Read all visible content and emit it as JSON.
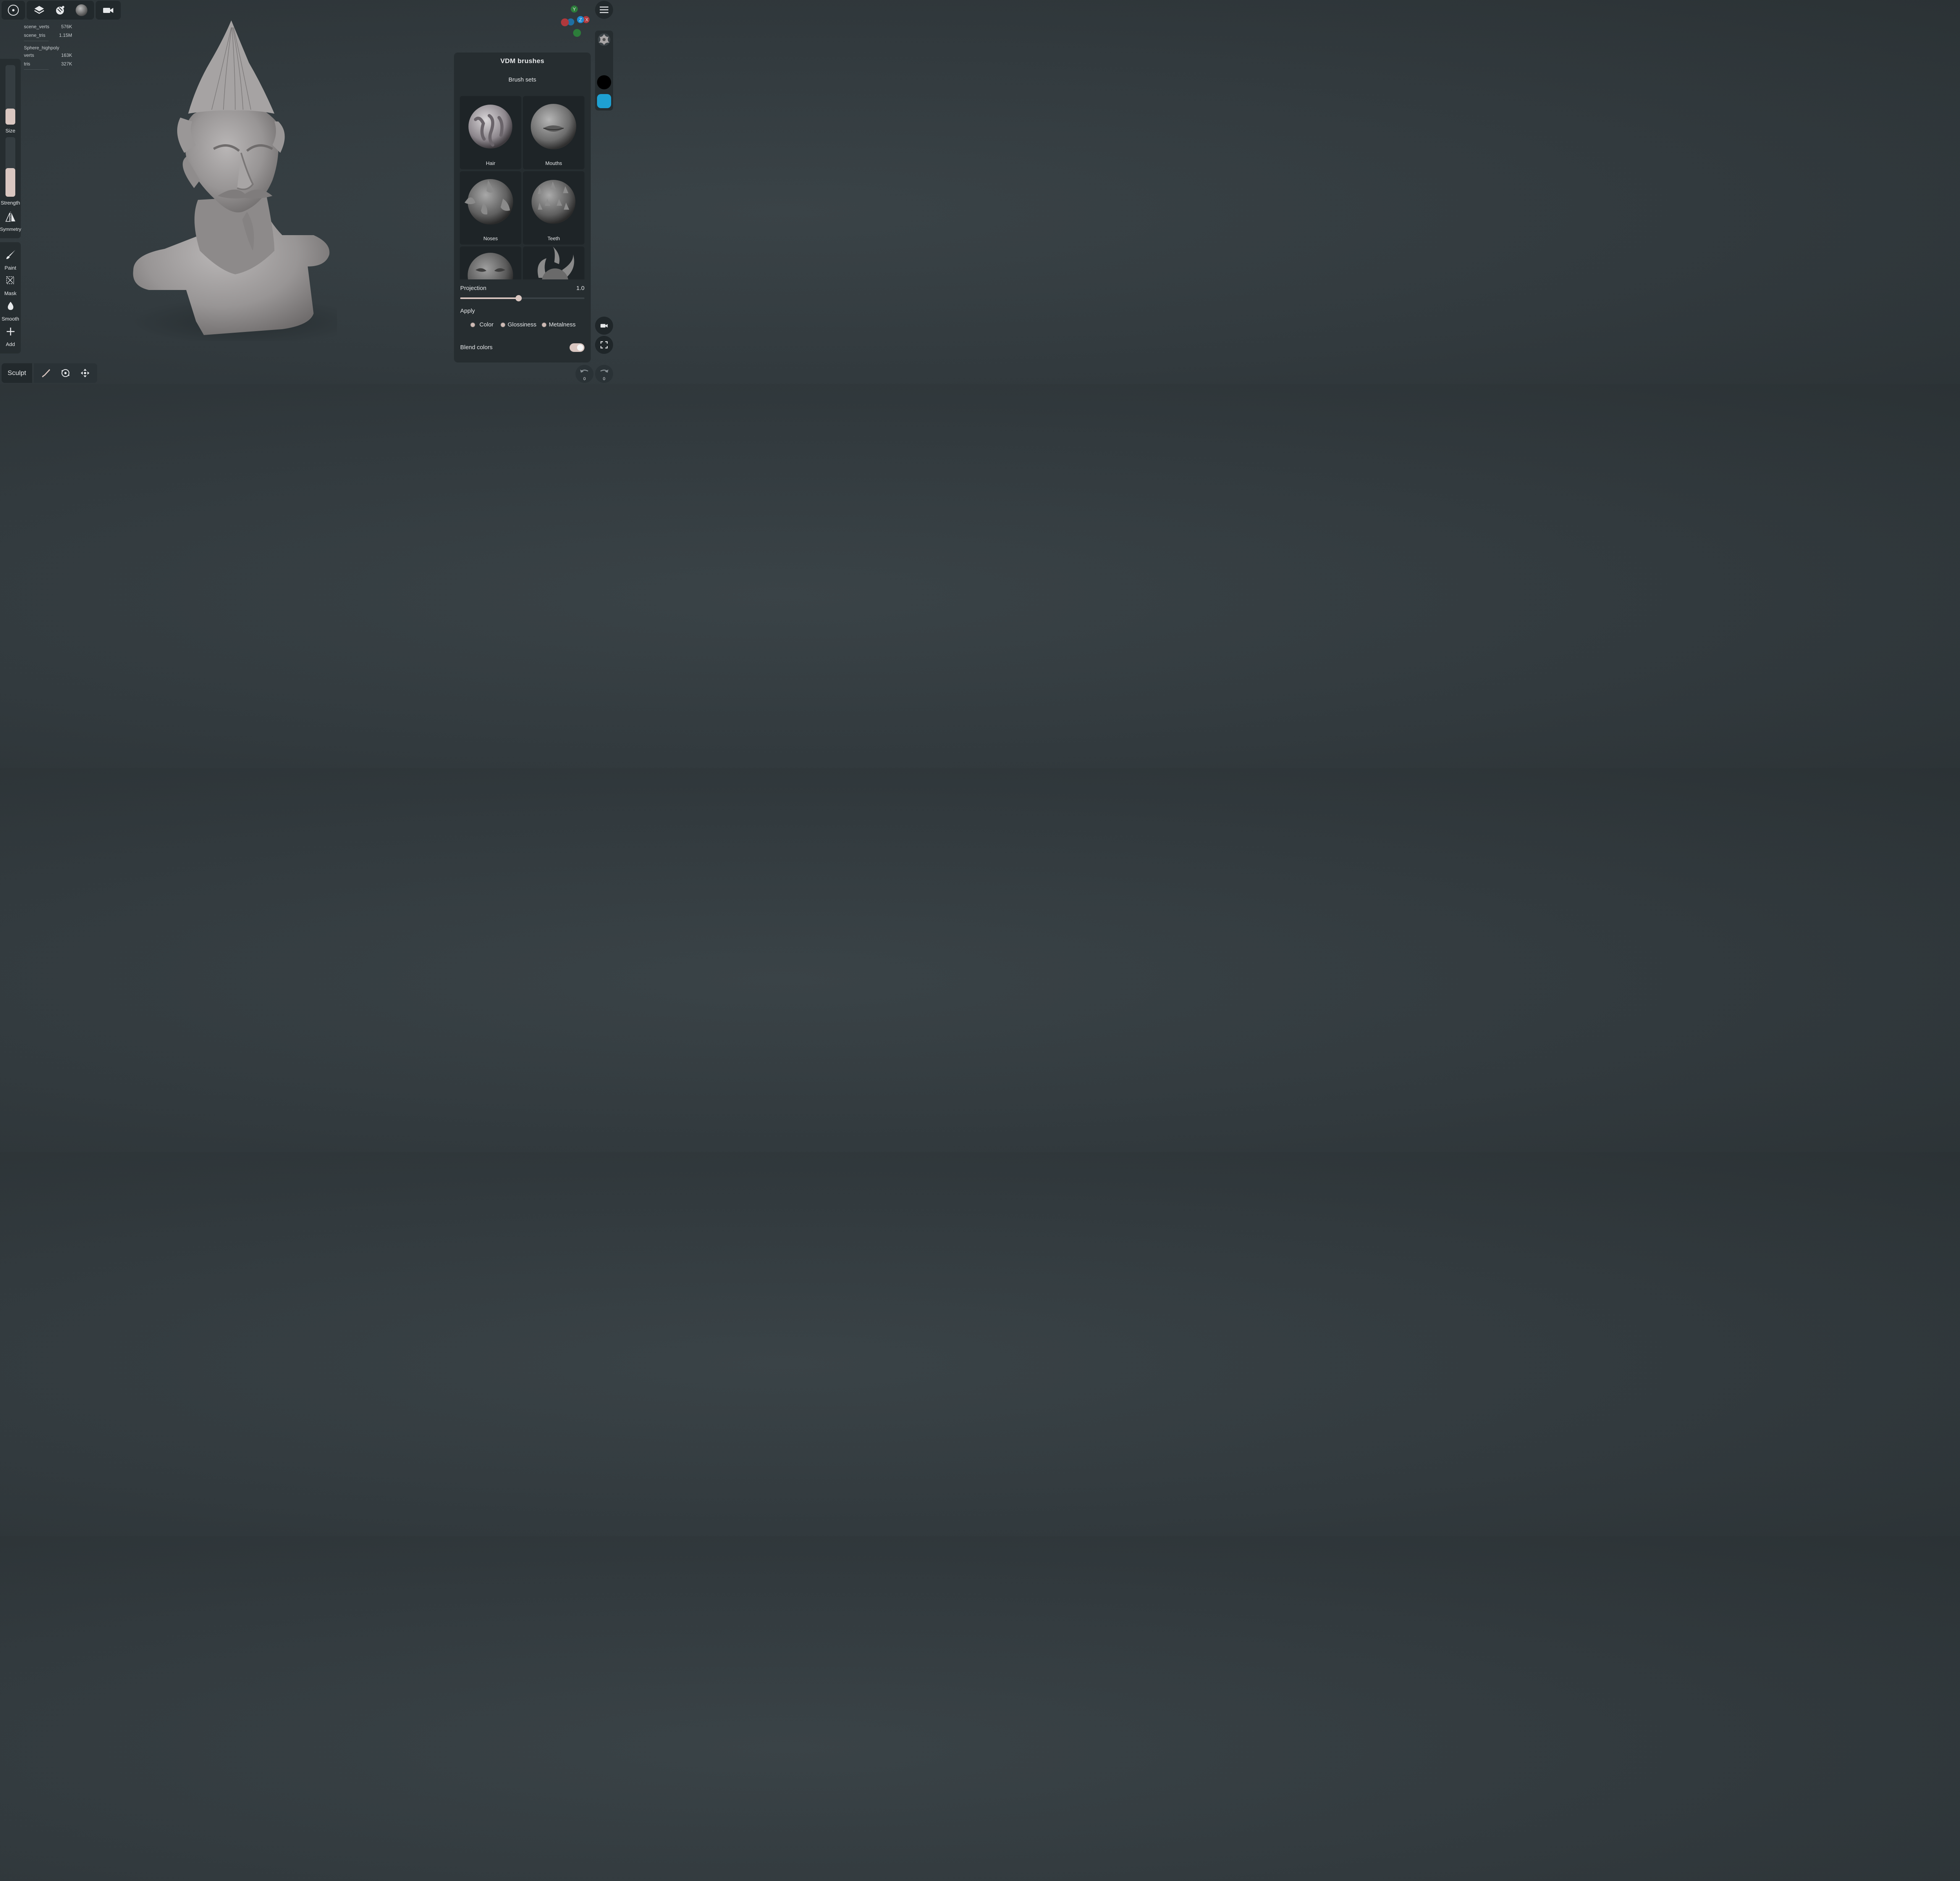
{
  "toolbar": {
    "items": [
      "menu-circle-icon",
      "layers-icon",
      "scene-globe-icon",
      "material-sphere-icon"
    ],
    "camera": "camera-icon"
  },
  "stats": {
    "scene_verts_label": "scene_verts",
    "scene_verts_value": "576K",
    "scene_tris_label": "scene_tris",
    "scene_tris_value": "1.15M",
    "object_name": "Sphere_highpoly",
    "verts_label": "verts",
    "verts_value": "163K",
    "tris_label": "tris",
    "tris_value": "327K"
  },
  "left_panel": {
    "size_label": "Size",
    "size_level": 0.27,
    "strength_label": "Strength",
    "strength_level": 0.48,
    "symmetry_label": "Symmetry",
    "paint_label": "Paint",
    "mask_label": "Mask",
    "smooth_label": "Smooth",
    "add_label": "Add"
  },
  "bottom_bar": {
    "mode_label": "Sculpt",
    "tools": [
      "brush-tool-icon",
      "transform-gizmo-icon",
      "move-arrows-icon"
    ]
  },
  "gizmo": {
    "y": "Y",
    "z": "Z",
    "x": "X"
  },
  "right_column": {
    "primary_color": "#000000",
    "secondary_color": "#1ea0d2"
  },
  "undo": {
    "undo_count": "0",
    "redo_count": "0"
  },
  "vdm_panel": {
    "title": "VDM brushes",
    "subtitle": "Brush sets",
    "sets": [
      {
        "label": "Hair"
      },
      {
        "label": "Mouths"
      },
      {
        "label": "Noses"
      },
      {
        "label": "Teeth"
      },
      {
        "label": ""
      },
      {
        "label": ""
      }
    ],
    "projection_label": "Projection",
    "projection_value": "1.0",
    "projection_level": 0.47,
    "apply_label": "Apply",
    "apply_options": [
      "Color",
      "Glossiness",
      "Metalness"
    ],
    "blend_label": "Blend colors",
    "blend_on": true
  },
  "colors": {
    "accent": "#d9c6c0",
    "panel": "#262d30",
    "background": "#323a3e"
  }
}
